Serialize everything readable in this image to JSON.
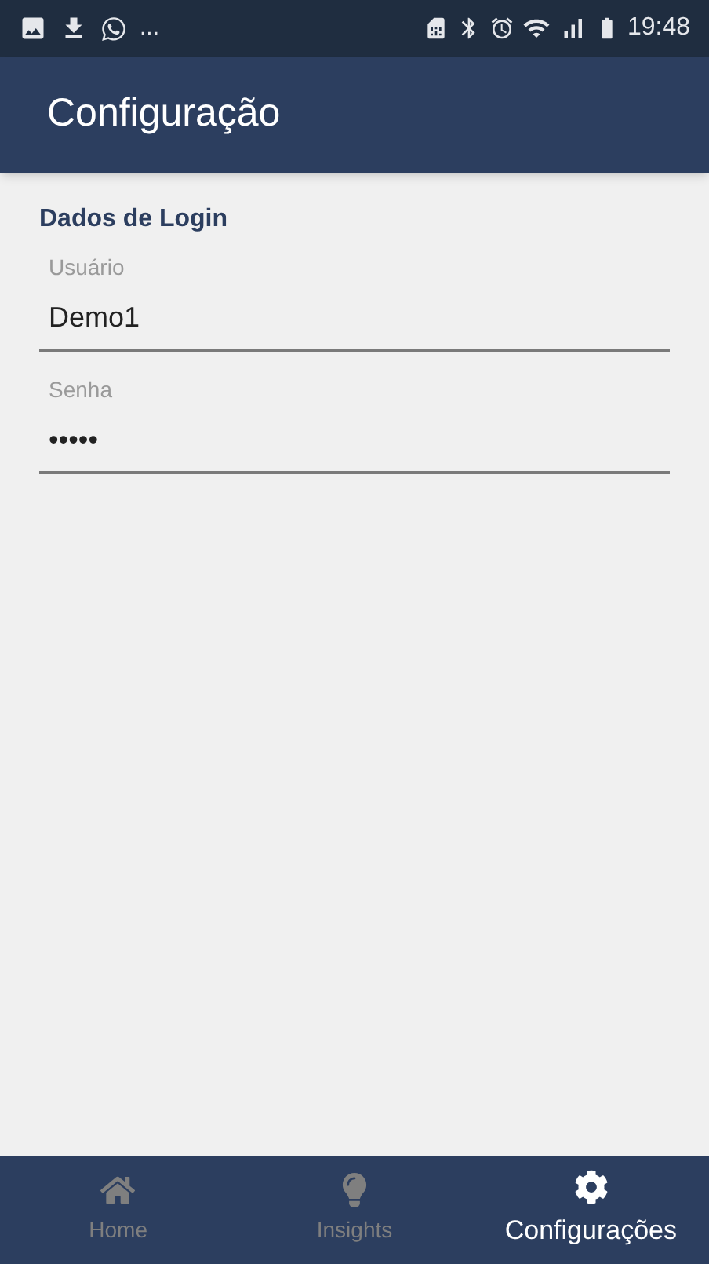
{
  "status_bar": {
    "overflow": "...",
    "time": "19:48"
  },
  "header": {
    "title": "Configuração"
  },
  "section": {
    "title": "Dados de Login"
  },
  "fields": [
    {
      "label": "Usuário",
      "value": "Demo1"
    },
    {
      "label": "Senha",
      "value": "•••••"
    }
  ],
  "tabs": [
    {
      "label": "Home",
      "kind": "home",
      "selected": false
    },
    {
      "label": "Insights",
      "kind": "bulb",
      "selected": false
    },
    {
      "label": "Configurações",
      "kind": "gear",
      "selected": true
    }
  ]
}
